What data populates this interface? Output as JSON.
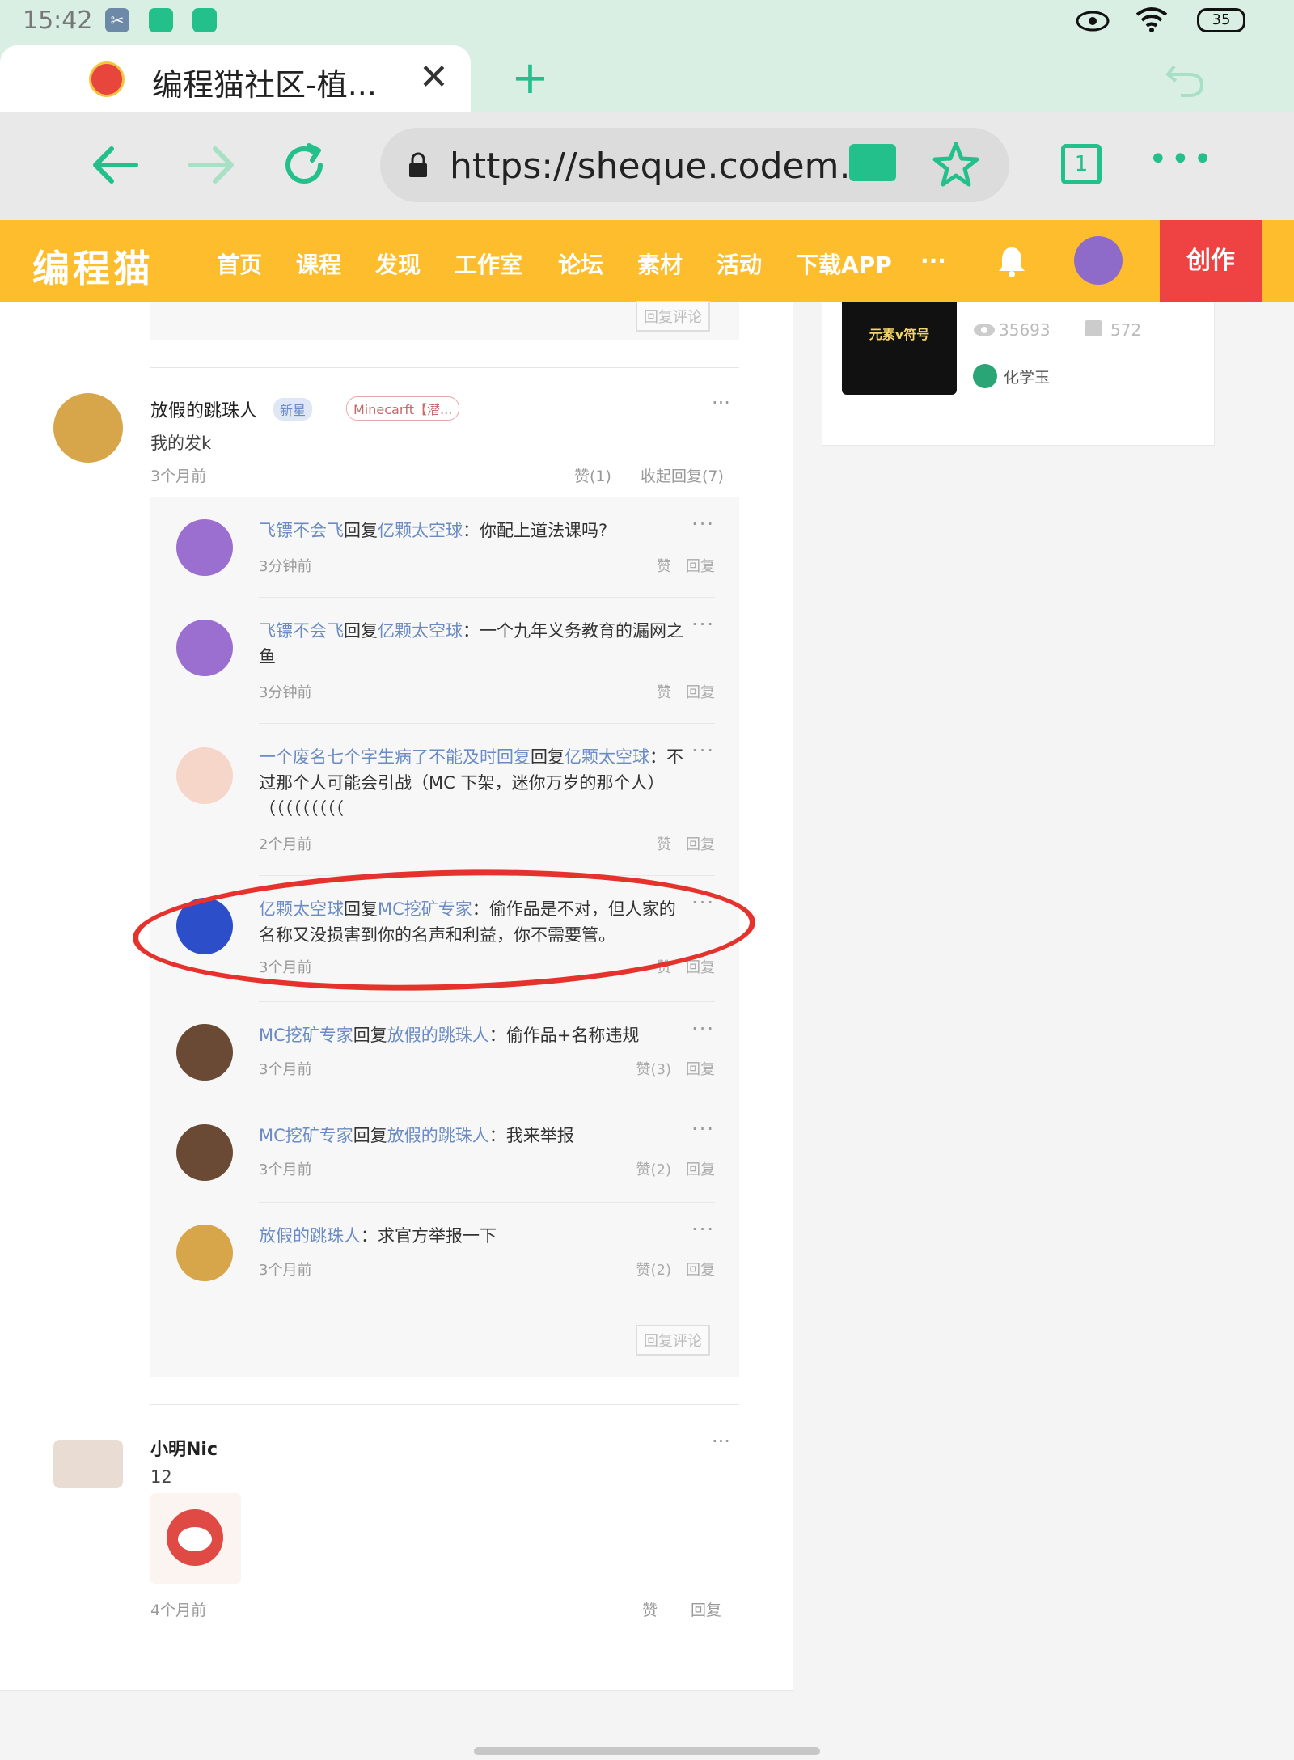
{
  "status": {
    "time": "15:42",
    "battery": "35"
  },
  "browser": {
    "tab_title": "编程猫社区-植...",
    "url": "https://sheque.codem...",
    "tab_count": "1"
  },
  "site_nav": {
    "logo": "编程猫",
    "items": [
      "首页",
      "课程",
      "发现",
      "工作室",
      "论坛",
      "素材",
      "活动",
      "下载APP"
    ],
    "more": "···",
    "create": "创作"
  },
  "top_reply_button": "回复评论",
  "side_card": {
    "thumb_title": "元素v符号",
    "views": "35693",
    "likes": "572",
    "author": "化学玉"
  },
  "comment1": {
    "author": "放假的跳珠人",
    "badge": "新星",
    "tag": "Minecarft【潜...",
    "text": "我的发k",
    "time": "3个月前",
    "likes": "赞(1)",
    "collapse": "收起回复(7)"
  },
  "replies": [
    {
      "from": "飞镖不会飞",
      "to": "亿颗太空球",
      "text": "你配上道法课吗?",
      "time": "3分钟前",
      "likes": "赞",
      "reply": "回复"
    },
    {
      "from": "飞镖不会飞",
      "to": "亿颗太空球",
      "text": "一个九年义务教育的漏网之鱼",
      "time": "3分钟前",
      "likes": "赞",
      "reply": "回复"
    },
    {
      "from": "一个废名七个字生病了不能及时回复",
      "to": "亿颗太空球",
      "text": "不过那个人可能会引战（MC 下架，迷你万岁的那个人）（（（（（（（（（",
      "time": "2个月前",
      "likes": "赞",
      "reply": "回复"
    },
    {
      "from": "亿颗太空球",
      "to": "MC挖矿专家",
      "text": "偷作品是不对，但人家的名称又没损害到你的名声和利益，你不需要管。",
      "time": "3个月前",
      "likes": "赞",
      "reply": "回复"
    },
    {
      "from": "MC挖矿专家",
      "to": "放假的跳珠人",
      "text": "偷作品+名称违规",
      "time": "3个月前",
      "likes": "赞(3)",
      "reply": "回复"
    },
    {
      "from": "MC挖矿专家",
      "to": "放假的跳珠人",
      "text": "我来举报",
      "time": "3个月前",
      "likes": "赞(2)",
      "reply": "回复"
    },
    {
      "from": "放假的跳珠人",
      "to": "",
      "text": "求官方举报一下",
      "time": "3个月前",
      "likes": "赞(2)",
      "reply": "回复"
    }
  ],
  "reply_word": "回复",
  "reply_comment_button": "回复评论",
  "comment2": {
    "author": "小明Nic",
    "text": "12",
    "time": "4个月前",
    "likes": "赞",
    "reply": "回复"
  },
  "colors": {
    "brand": "#fdbd2d",
    "create": "#ef4343",
    "link": "#6a8bc4",
    "highlight": "#e6322c"
  }
}
